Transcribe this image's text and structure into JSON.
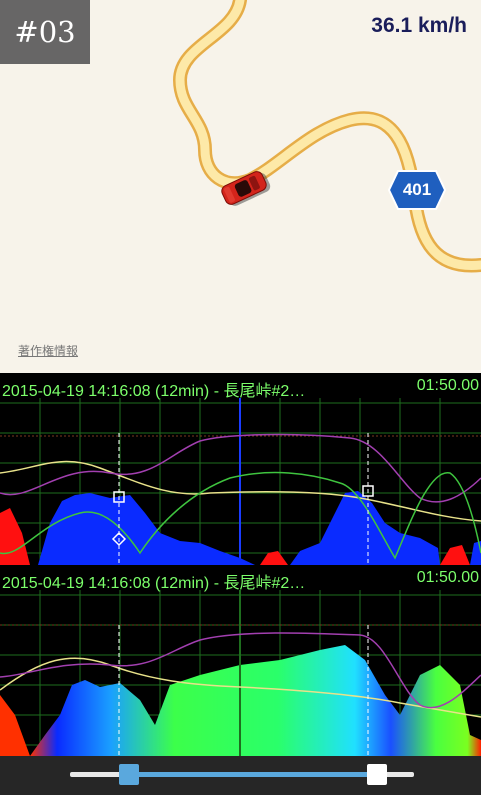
{
  "map": {
    "index_label": "#03",
    "speed": "36.1 km/h",
    "copyright": "著作権情報",
    "route_shield": "401",
    "colors": {
      "land": "#f7f3ea",
      "road": "#f6c35a",
      "shield": "#1f5fbf",
      "car": "#d3241b"
    }
  },
  "charts": [
    {
      "header_left": "2015-04-19 14:16:08 (12min) - 長尾峠#2…",
      "header_right": "01:50.00"
    },
    {
      "header_left": "2015-04-19 14:16:08 (12min) - 長尾峠#2…",
      "header_right": "01:50.00"
    }
  ],
  "playback": {
    "range_start": 0.17,
    "range_end": 0.86
  },
  "colors": {
    "grid": "#1e6e1e",
    "header_text": "#7cff6b",
    "speed_fill": "#0a2bff",
    "brake_fill": "#ff1010",
    "line_green": "#3fc43f",
    "line_yellow": "#e8e28a",
    "line_purple": "#a23fb0",
    "slider_accent": "#5aa8dd"
  }
}
